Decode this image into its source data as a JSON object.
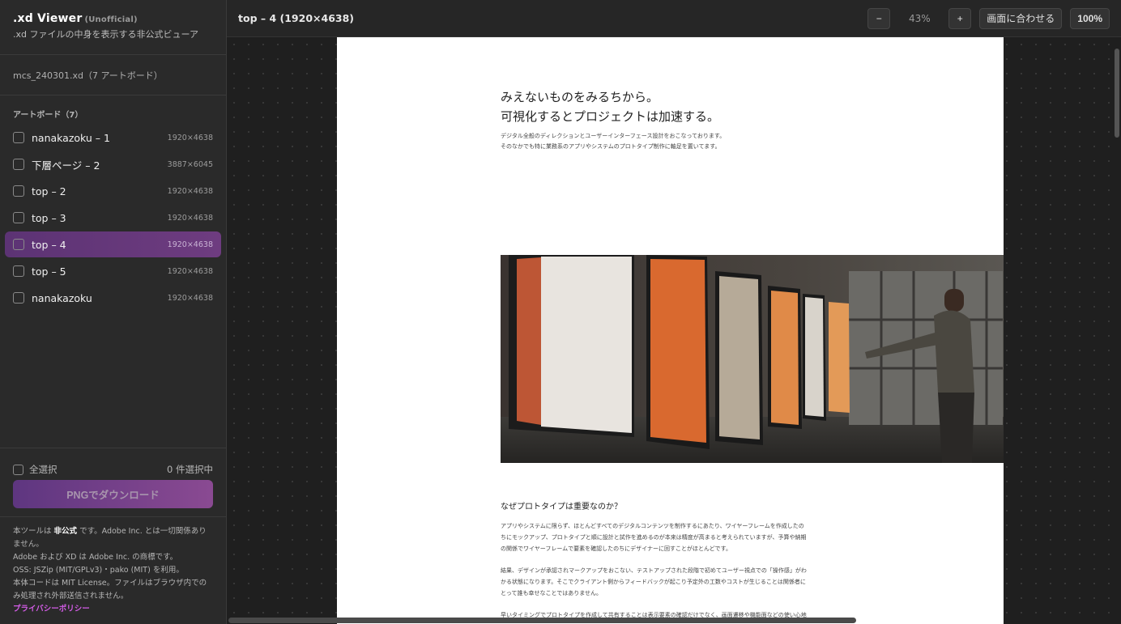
{
  "sidebar": {
    "title": ".xd Viewer",
    "title_badge": "(Unofficial)",
    "subtitle": ".xd ファイルの中身を表示する非公式ビューア",
    "file_info": "mcs_240301.xd（7 アートボード）",
    "artboards_heading": "アートボード（7）",
    "artboards": [
      {
        "name": "nanakazoku – 1",
        "size": "1920×4638",
        "active": false
      },
      {
        "name": "下層ページ – 2",
        "size": "3887×6045",
        "active": false
      },
      {
        "name": "top – 2",
        "size": "1920×4638",
        "active": false
      },
      {
        "name": "top – 3",
        "size": "1920×4638",
        "active": false
      },
      {
        "name": "top – 4",
        "size": "1920×4638",
        "active": true
      },
      {
        "name": "top – 5",
        "size": "1920×4638",
        "active": false
      },
      {
        "name": "nanakazoku",
        "size": "1920×4638",
        "active": false
      }
    ],
    "select_all_label": "全選択",
    "selected_count": "0 件選択中",
    "download_label": "PNGでダウンロード",
    "notice": {
      "line1_pre": "本ツールは ",
      "line1_bold": "非公式",
      "line1_post": " です。Adobe Inc. とは一切関係ありません。",
      "line2": "Adobe および XD は Adobe Inc. の商標です。",
      "line3": "OSS: JSZip (MIT/GPLv3)・pako (MIT) を利用。",
      "line4": "本体コードは MIT License。ファイルはブラウザ内でのみ処理され外部送信されません。",
      "privacy_link": "プライバシーポリシー"
    }
  },
  "toolbar": {
    "title": "top – 4 (1920×4638)",
    "zoom_out": "−",
    "zoom_level": "43%",
    "zoom_in": "+",
    "fit": "画面に合わせる",
    "actual": "100%"
  },
  "artboard": {
    "hero_line1": "みえないものをみるちから。",
    "hero_line2": "可視化するとプロジェクトは加速する。",
    "hero_desc1": "デジタル全般のディレクションとユーザーインターフェース設計をおこなっております。",
    "hero_desc2": "そのなかでも特に業務系のアプリやシステムのプロトタイプ制作に軸足を置いてます。",
    "section_title": "なぜプロトタイプは重要なのか？",
    "para1_l1": "アプリやシステムに限らず、ほとんどすべてのデジタルコンテンツを制作するにあたり、ワイヤーフレームを作成したの",
    "para1_l2": "ちにモックアップ、プロトタイプと順に設計と試作を進めるのが本来は精度が高まると考えられていますが、予算や納期",
    "para1_l3": "の関係でワイヤーフレームで要素を確認したのちにデザイナーに回すことがほとんどです。",
    "para2_l1": "結果、デザインが承認されマークアップをおこない、テストアップされた段階で初めてユーザー視点での「操作感」がわ",
    "para2_l2": "かる状態になります。そこでクライアント側からフィードバックが起こり予定外の工数やコストが生じることは関係者に",
    "para2_l3": "とって誰も幸せなことではありません。",
    "para3_l1": "早いタイミングでプロトタイプを作成して共有することは表示要素の確認だけでなく、画面遷移や機能面などの使い心地"
  }
}
